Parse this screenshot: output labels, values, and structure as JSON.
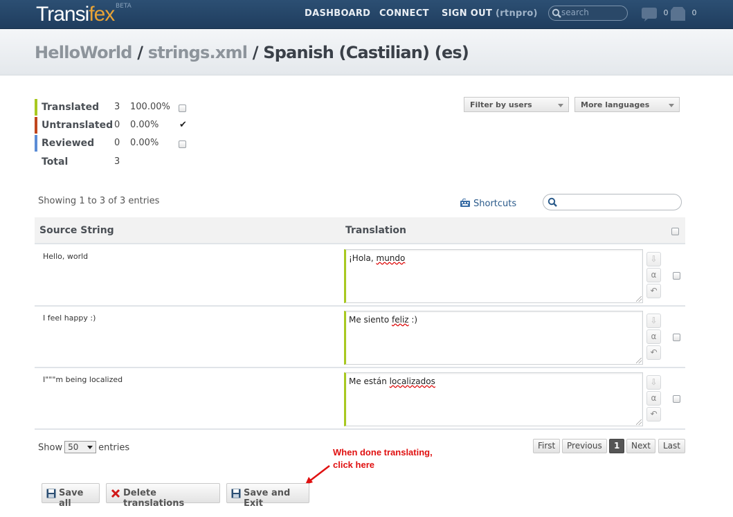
{
  "header": {
    "logo_main": "Transi",
    "logo_accent": "fex",
    "beta": "BETA",
    "nav": {
      "dashboard": "DASHBOARD",
      "connect": "CONNECT",
      "signout": "SIGN OUT",
      "user": "(rtnpro)"
    },
    "search_placeholder": "search",
    "notifications_count": "0",
    "messages_count": "0"
  },
  "breadcrumb": {
    "project": "HelloWorld",
    "sep1": "/",
    "resource": "strings.xml",
    "sep2": "/",
    "language": "Spanish (Castilian) (es)"
  },
  "stats": [
    {
      "label": "Translated",
      "count": "3",
      "percent": "100.00%",
      "checked": false,
      "color": "#a8c920"
    },
    {
      "label": "Untranslated",
      "count": "0",
      "percent": "0.00%",
      "checked": true,
      "color": "#c0461e"
    },
    {
      "label": "Reviewed",
      "count": "0",
      "percent": "0.00%",
      "checked": false,
      "color": "#5b8dd6"
    },
    {
      "label": "Total",
      "count": "3"
    }
  ],
  "filters": {
    "users": "Filter by users",
    "languages": "More languages"
  },
  "table": {
    "showing": "Showing 1 to 3 of 3 entries",
    "shortcuts": "Shortcuts",
    "col_source": "Source String",
    "col_translation": "Translation",
    "rows": [
      {
        "source": "Hello, world",
        "pre": "¡Hola, ",
        "word": "mundo",
        "post": ""
      },
      {
        "source": "I feel happy :)",
        "pre": "Me siento ",
        "word": "feliz",
        "post": " :)"
      },
      {
        "source": "I\"\"\"m being localized",
        "pre": "Me están ",
        "word": "localizados",
        "post": ""
      }
    ]
  },
  "footer": {
    "show": "Show",
    "entries_value": "50",
    "entries": "entries",
    "pagination": {
      "first": "First",
      "previous": "Previous",
      "current": "1",
      "next": "Next",
      "last": "Last"
    },
    "note_line1": "When done translating,",
    "note_line2": "click here",
    "save_all": "Save all",
    "delete": "Delete translations",
    "save_exit": "Save and Exit"
  },
  "colors": {
    "accent_green": "#a8c920",
    "header_blue": "#1f3d5e",
    "note_red": "#e01010"
  }
}
